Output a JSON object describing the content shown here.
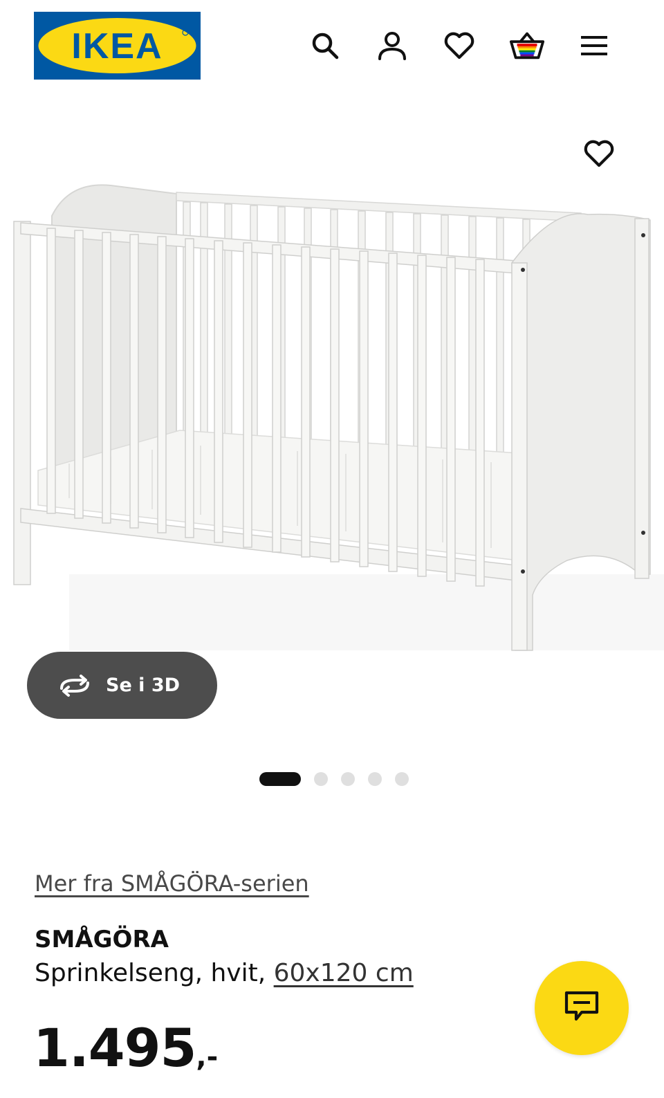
{
  "header": {
    "logo_text": "IKEA",
    "icons": [
      "search-icon",
      "account-icon",
      "favourites-icon",
      "basket-icon",
      "menu-icon"
    ]
  },
  "gallery": {
    "favourite_icon": "heart-icon",
    "view_3d_label": "Se i 3D",
    "image_count": 5,
    "active_image_index": 0
  },
  "product": {
    "series_link": "Mer fra SMÅGÖRA-serien",
    "name": "SMÅGÖRA",
    "description_prefix": "Sprinkelseng, hvit, ",
    "size_link": "60x120 cm",
    "price_integer": "1.495",
    "price_suffix": ",-"
  },
  "chat": {
    "icon": "chat-icon"
  },
  "colors": {
    "ikea_blue": "#0058a3",
    "ikea_yellow": "#fbd914",
    "button_dark": "#4d4d4d",
    "dot_active": "#111111",
    "dot_inactive": "#dfdfdf"
  }
}
